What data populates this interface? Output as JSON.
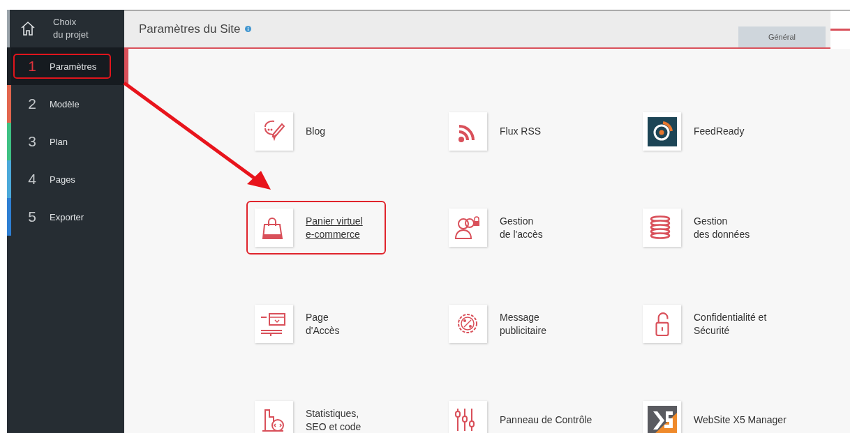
{
  "sidebar": {
    "project": {
      "label_line_1": "Choix",
      "label_line_2": "du projet"
    },
    "steps": [
      {
        "number": "1",
        "label": "Paramètres",
        "color": "#1b2025",
        "selected": true,
        "highlighted": true
      },
      {
        "number": "2",
        "label": "Modèle",
        "color": "#e2664e",
        "selected": false,
        "highlighted": false
      },
      {
        "number": "3",
        "label": "Plan",
        "color": "#3ec184",
        "selected": false,
        "highlighted": false
      },
      {
        "number": "4",
        "label": "Pages",
        "color": "#4ba9da",
        "selected": false,
        "highlighted": false
      },
      {
        "number": "5",
        "label": "Exporter",
        "color": "#2e7fd3",
        "selected": false,
        "highlighted": false
      }
    ]
  },
  "header": {
    "title": "Paramètres du Site",
    "tabs": [
      {
        "label": "Général",
        "selected": true
      }
    ]
  },
  "items": [
    {
      "lines": [
        "Blog"
      ],
      "highlighted": false
    },
    {
      "lines": [
        "Flux RSS"
      ],
      "highlighted": false
    },
    {
      "lines": [
        "FeedReady"
      ],
      "highlighted": false
    },
    {
      "lines": [
        "Panier virtuel",
        "e-commerce"
      ],
      "highlighted": true
    },
    {
      "lines": [
        "Gestion",
        "de l'accès"
      ],
      "highlighted": false
    },
    {
      "lines": [
        "Gestion",
        "des données"
      ],
      "highlighted": false
    },
    {
      "lines": [
        "Page",
        "d'Accès"
      ],
      "highlighted": false
    },
    {
      "lines": [
        "Message",
        "publicitaire"
      ],
      "highlighted": false
    },
    {
      "lines": [
        "Confidentialité et",
        "Sécurité"
      ],
      "highlighted": false
    },
    {
      "lines": [
        "Statistiques,",
        "SEO et code"
      ],
      "highlighted": false
    },
    {
      "lines": [
        "Panneau de Contrôle"
      ],
      "highlighted": false
    },
    {
      "lines": [
        "WebSite X5 Manager"
      ],
      "highlighted": false
    }
  ]
}
